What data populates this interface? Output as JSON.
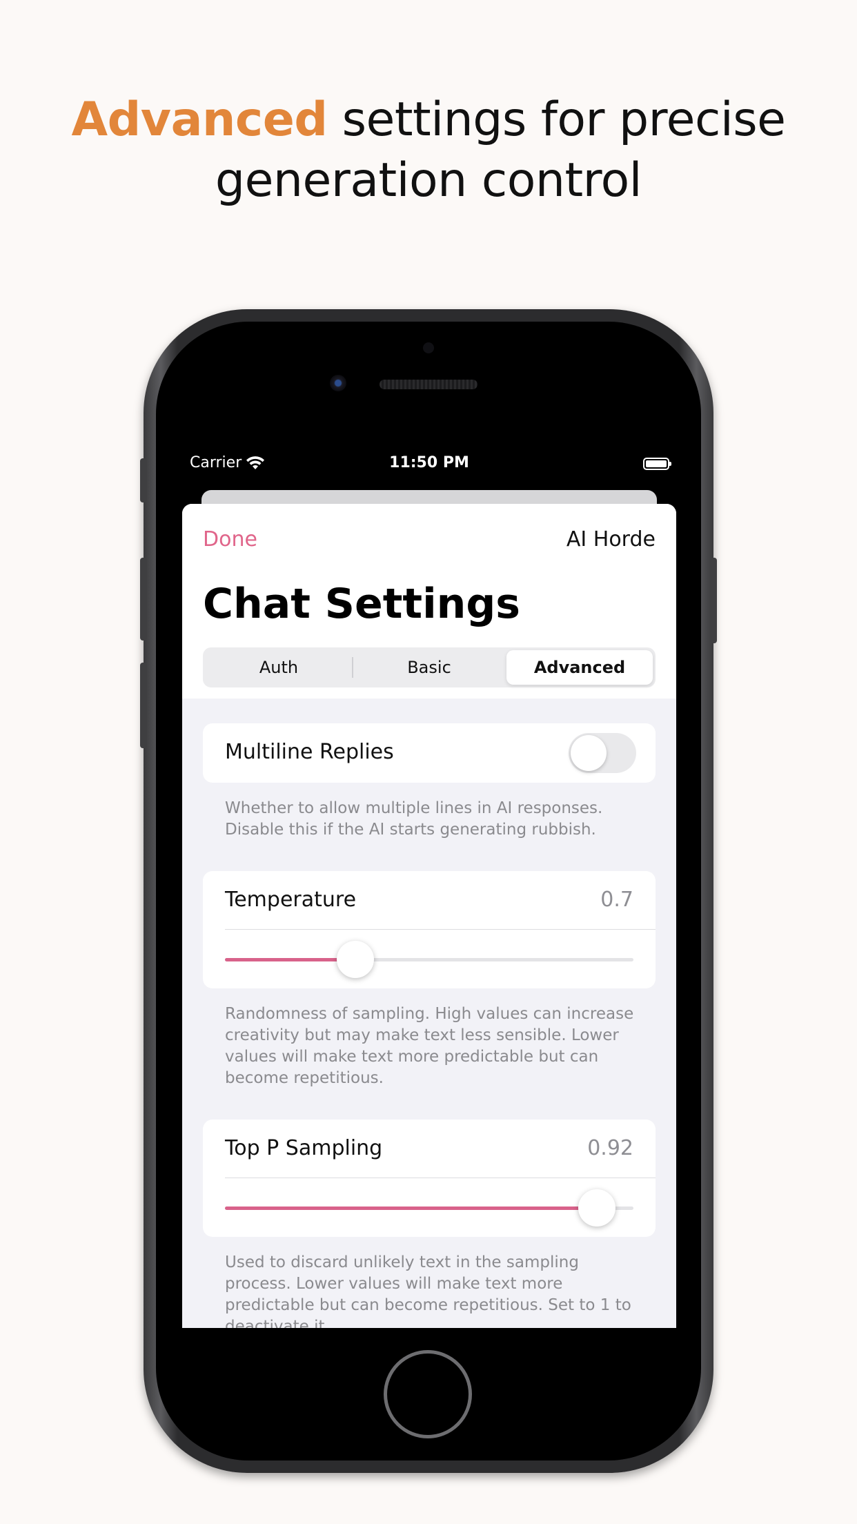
{
  "headline": {
    "highlight": "Advanced",
    "rest_line1": " settings for precise",
    "line2": "generation control"
  },
  "colors": {
    "accent": "#e2863a",
    "tint": "#e0658a",
    "slider_fill": "#d8628a",
    "background": "#fcf9f7"
  },
  "status_bar": {
    "carrier": "Carrier",
    "time": "11:50 PM",
    "wifi_icon": "wifi-icon",
    "battery_icon": "battery-icon"
  },
  "nav": {
    "done_label": "Done",
    "provider_label": "AI Horde",
    "title": "Chat Settings"
  },
  "tabs": [
    {
      "label": "Auth",
      "selected": false
    },
    {
      "label": "Basic",
      "selected": false
    },
    {
      "label": "Advanced",
      "selected": true
    }
  ],
  "settings": {
    "multiline": {
      "label": "Multiline Replies",
      "enabled": false,
      "footnote_line1": "Whether to allow multiple lines in AI responses.",
      "footnote_line2": "Disable this if the AI starts generating rubbish."
    },
    "temperature": {
      "label": "Temperature",
      "value": "0.7",
      "slider_fraction": 0.32,
      "footnote_line1": "Randomness of sampling. High values can increase",
      "footnote_line2": "creativity but may make text less sensible. Lower",
      "footnote_line3": "values will make text more predictable but can",
      "footnote_line4": "become repetitious."
    },
    "top_p": {
      "label": "Top P Sampling",
      "value": "0.92",
      "slider_fraction": 0.91,
      "footnote_line1": "Used to discard unlikely text in the sampling",
      "footnote_line2": "process. Lower values will make text more",
      "footnote_line3": "predictable but can become repetitious. Set to 1 to",
      "footnote_line4": "deactivate it."
    }
  }
}
